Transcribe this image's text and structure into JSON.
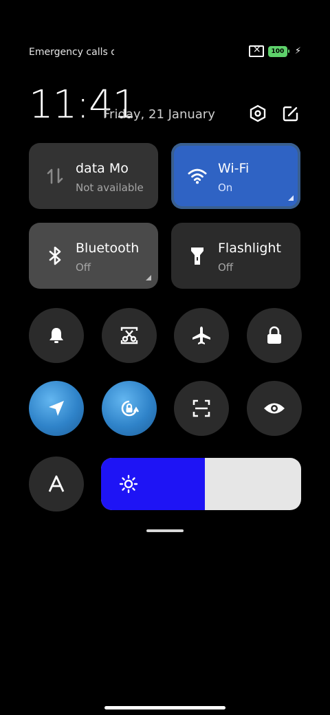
{
  "status": {
    "carrier": "Emergency calls o",
    "battery": "100"
  },
  "header": {
    "time": "11:41",
    "date": "Friday, 21 January"
  },
  "tiles": {
    "mobile": {
      "title": "data    Mo",
      "subtitle": "Not available"
    },
    "wifi": {
      "title": "Wi‑Fi",
      "subtitle": "On"
    },
    "bluetooth": {
      "title": "Bluetooth",
      "subtitle": "Off"
    },
    "flashlight": {
      "title": "Flashlight",
      "subtitle": "Off"
    }
  },
  "icons": {
    "settings": "settings-hexagon-icon",
    "edit": "edit-icon",
    "mobile_data": "mobile-data-arrows-icon",
    "wifi": "wifi-icon",
    "bluetooth": "bluetooth-icon",
    "flashlight": "flashlight-icon",
    "bell": "bell-icon",
    "screenshot": "screenshot-scissor-icon",
    "airplane": "airplane-icon",
    "lock": "lock-icon",
    "location": "location-arrow-icon",
    "rotation_lock": "rotation-lock-icon",
    "scan": "scan-icon",
    "eye": "eye-icon",
    "font": "auto-brightness-a-icon",
    "brightness": "sun-icon"
  },
  "brightness": {
    "level": 0.52
  },
  "colors": {
    "wifi_tile": "#2f63c4",
    "brightness_fill": "#1e14f5",
    "battery": "#5ed16b"
  }
}
